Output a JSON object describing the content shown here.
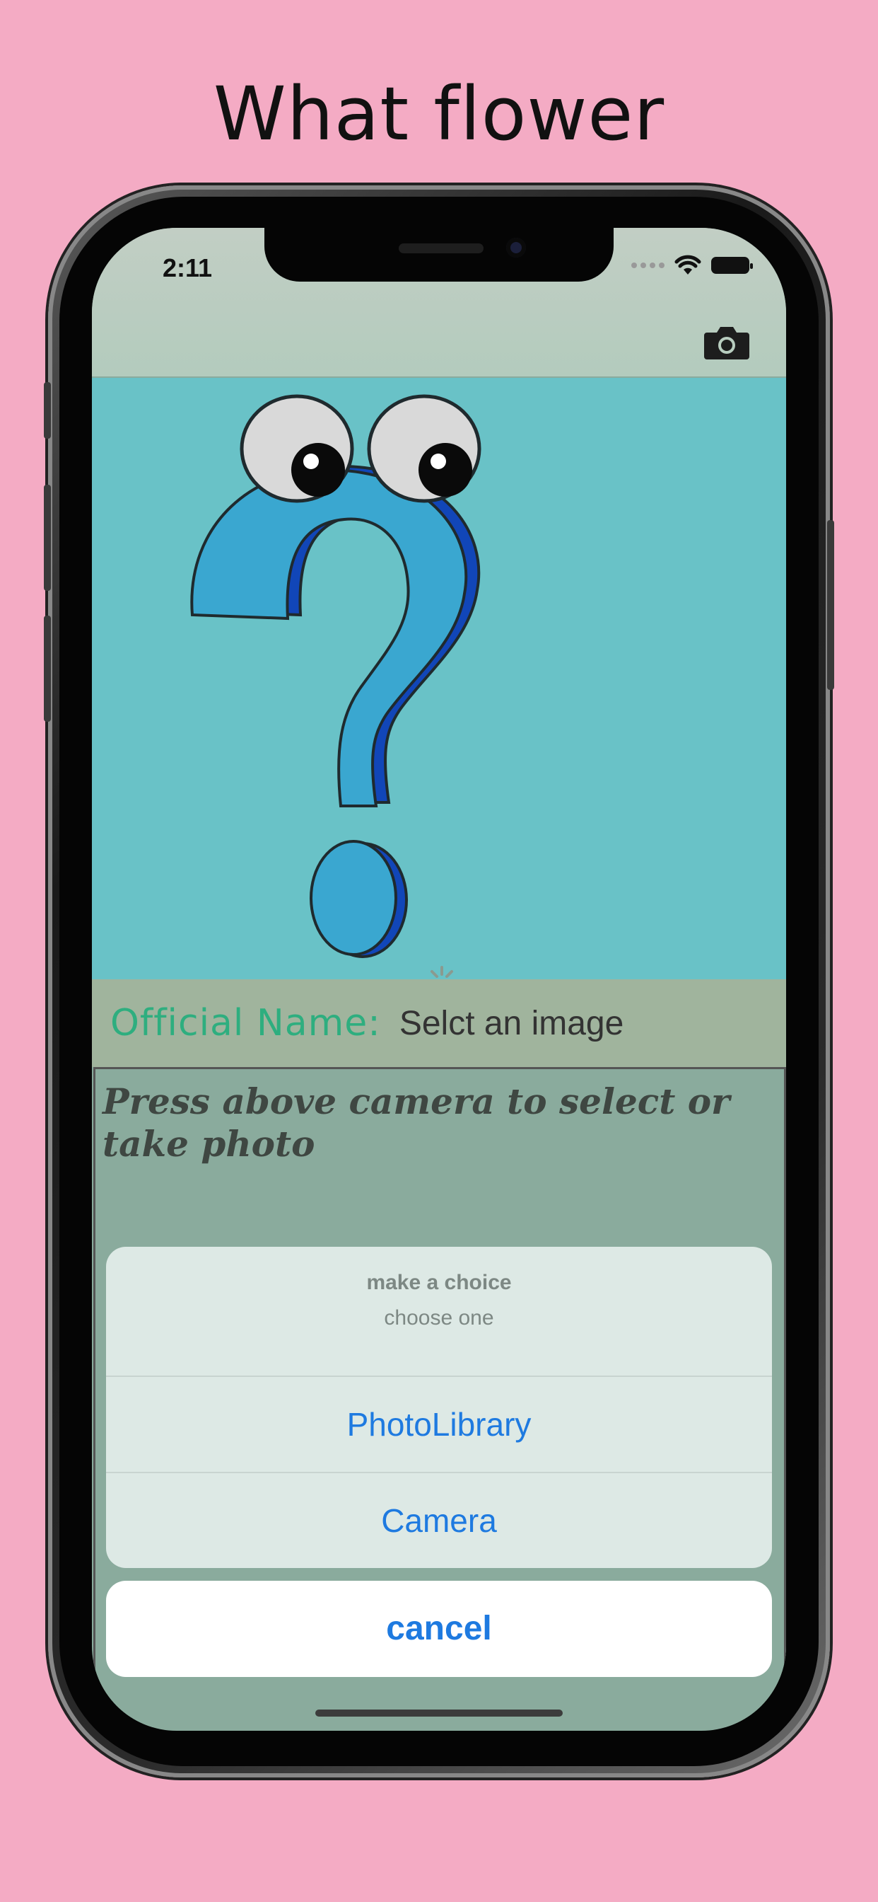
{
  "promo": {
    "title": "What flower"
  },
  "status_bar": {
    "time": "2:11"
  },
  "icons": {
    "camera": "camera-icon",
    "wifi": "wifi-icon",
    "battery": "battery-icon",
    "hero": "question-mark-illustration",
    "spinner": "activity-spinner"
  },
  "result": {
    "label": "Official Name:",
    "value": "Selct an image"
  },
  "description": {
    "text": "Press above camera to select or take photo"
  },
  "action_sheet": {
    "title": "make a choice",
    "message": "choose one",
    "actions": [
      {
        "label": "PhotoLibrary"
      },
      {
        "label": "Camera"
      }
    ],
    "cancel_label": "cancel"
  },
  "colors": {
    "background": "#f4abc4",
    "navbar": "#b8cdbf",
    "hero": "#69c2c7",
    "name_row": "#a0b49d",
    "name_label": "#2eae7f",
    "content": "#8aab9d",
    "action_blue": "#1e7ae0"
  }
}
